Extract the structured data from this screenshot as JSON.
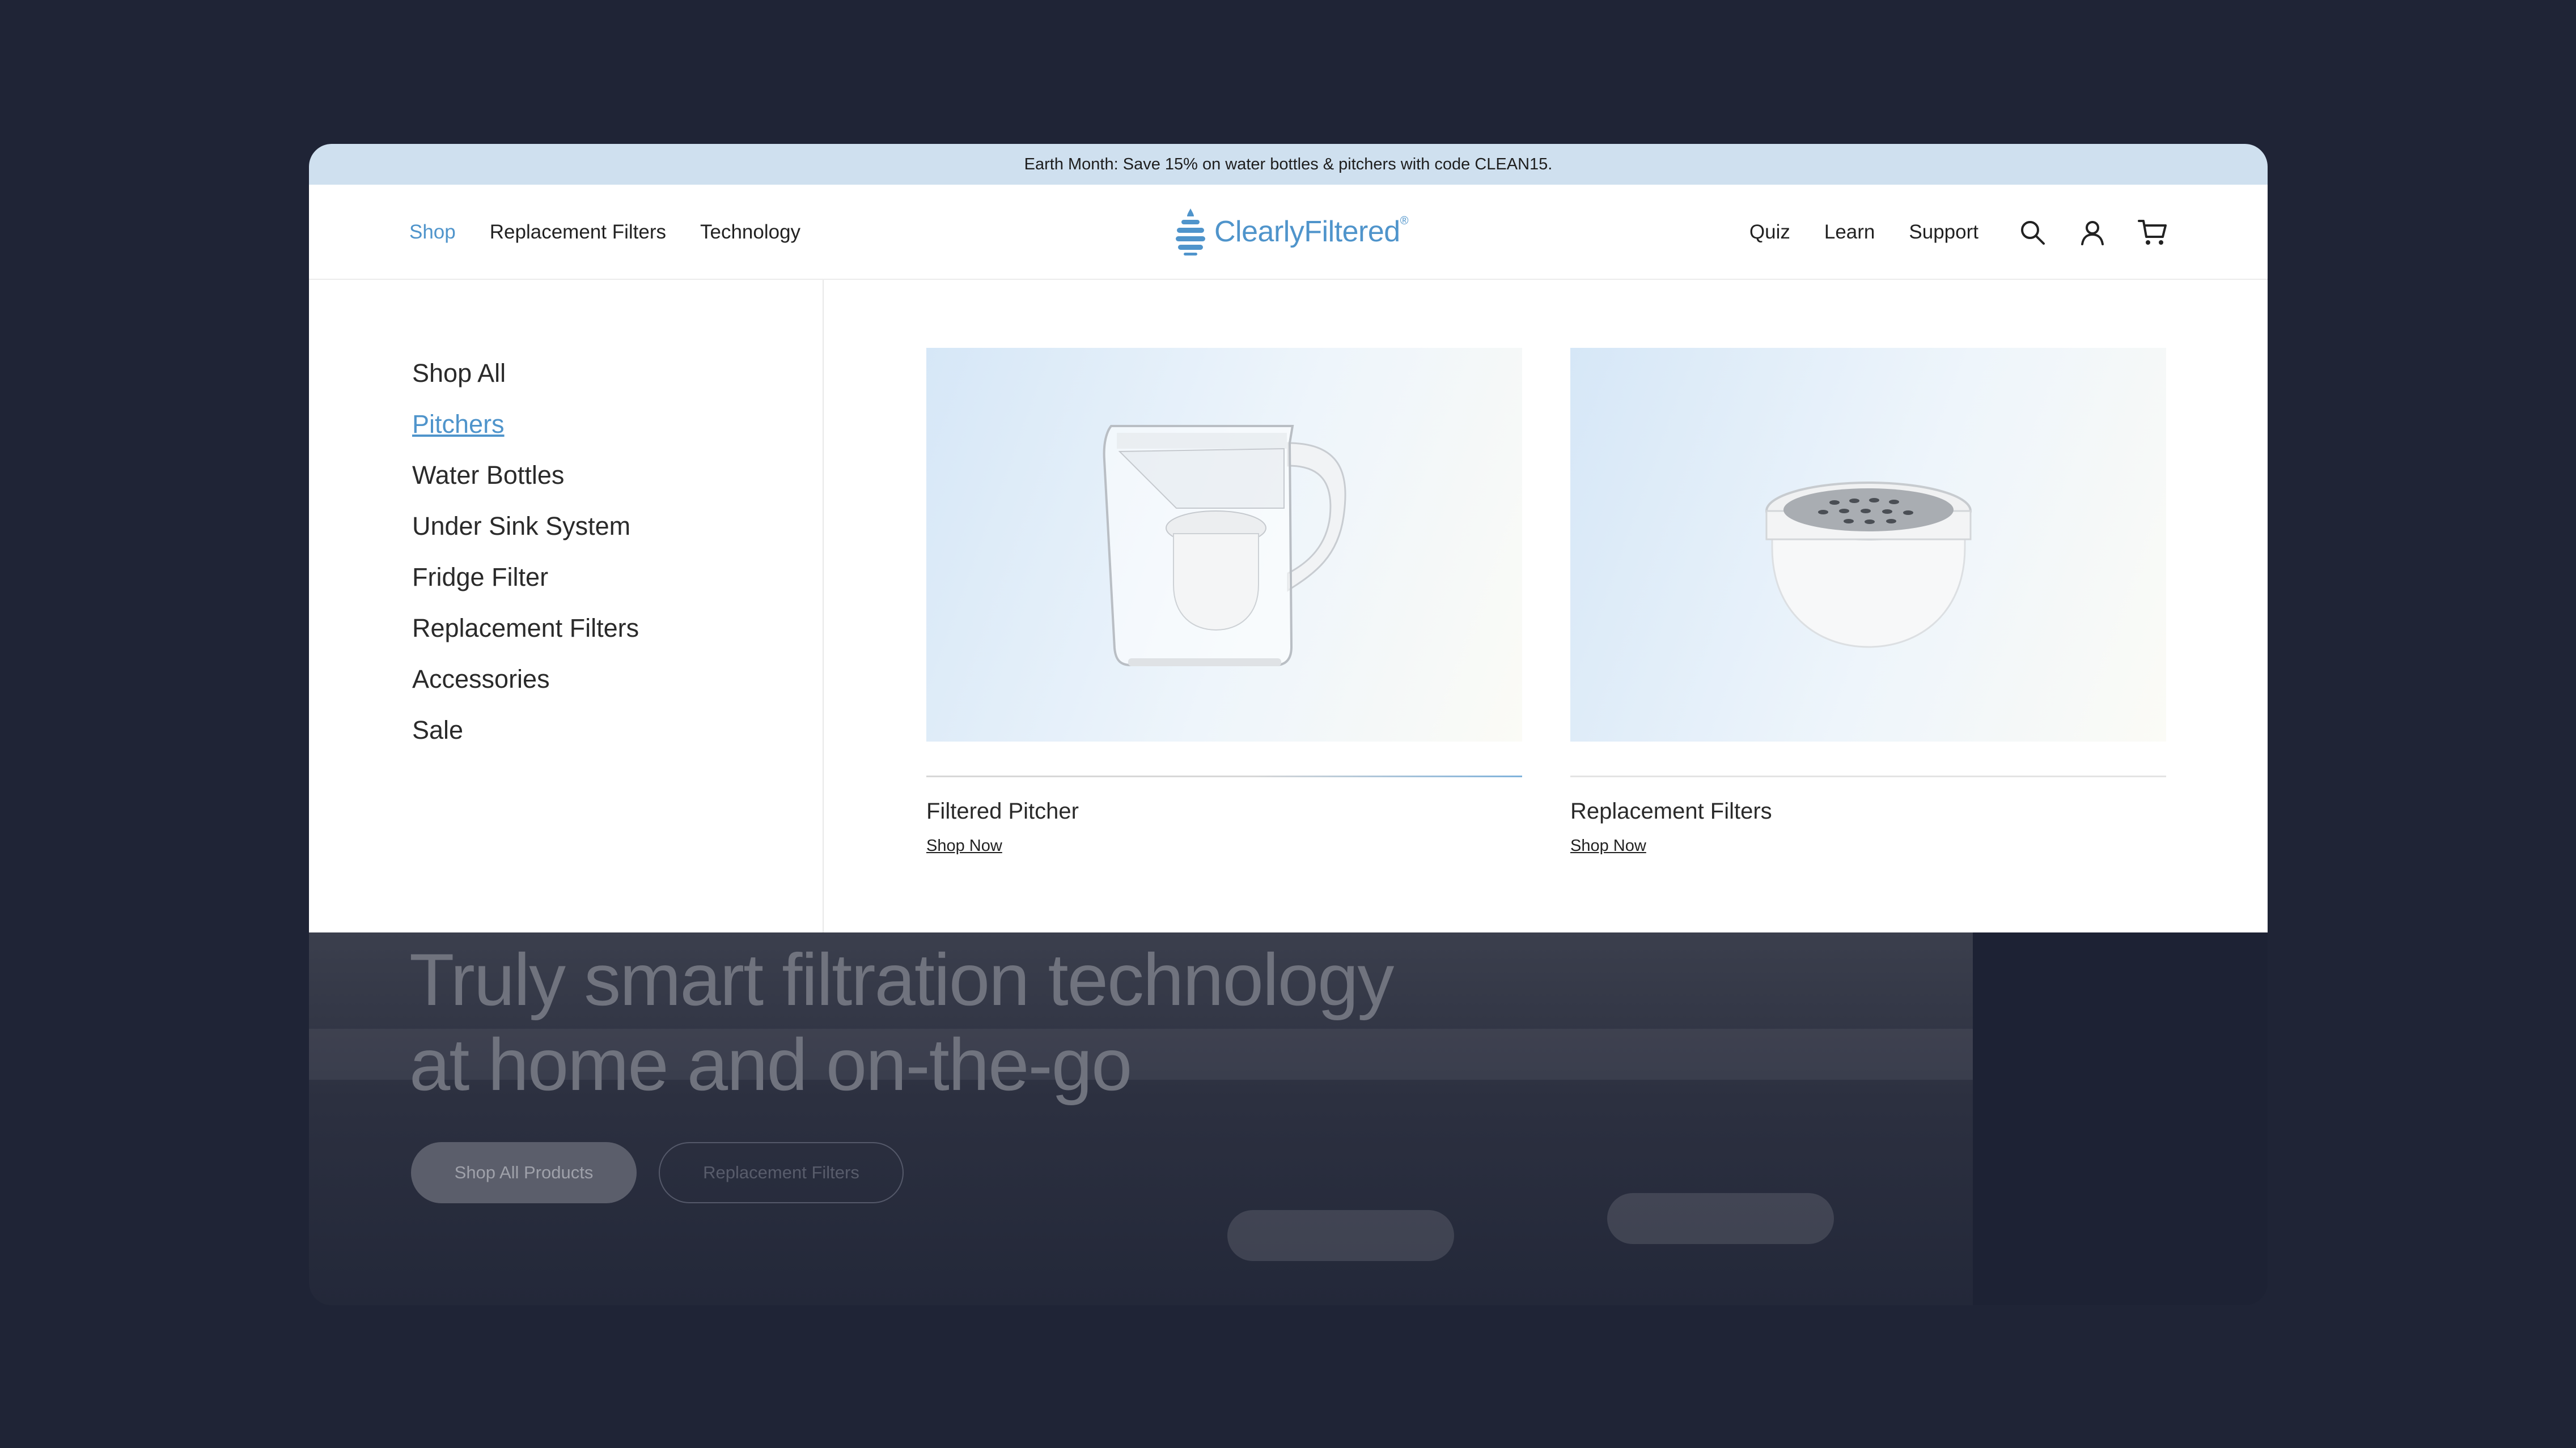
{
  "promo": {
    "text": "Earth Month: Save 15% on water bottles & pitchers with code CLEAN15."
  },
  "nav": {
    "left": [
      "Shop",
      "Replacement Filters",
      "Technology"
    ],
    "right": [
      "Quiz",
      "Learn",
      "Support"
    ],
    "active": "Shop"
  },
  "brand": {
    "name": "ClearlyFiltered",
    "reg": "®",
    "color": "#4f94cb"
  },
  "icons": [
    "search-icon",
    "account-icon",
    "cart-icon"
  ],
  "mega_menu": {
    "categories": [
      "Shop All",
      "Pitchers",
      "Water Bottles",
      "Under Sink System",
      "Fridge Filter",
      "Replacement Filters",
      "Accessories",
      "Sale"
    ],
    "active_category": "Pitchers",
    "cards": [
      {
        "title": "Filtered Pitcher",
        "link": "Shop Now"
      },
      {
        "title": "Replacement Filters",
        "link": "Shop Now"
      }
    ]
  },
  "hero": {
    "line1": "Truly smart filtration technology",
    "line2": "at home and on-the-go",
    "primary_button": "Shop All Products",
    "secondary_button": "Replacement Filters"
  }
}
